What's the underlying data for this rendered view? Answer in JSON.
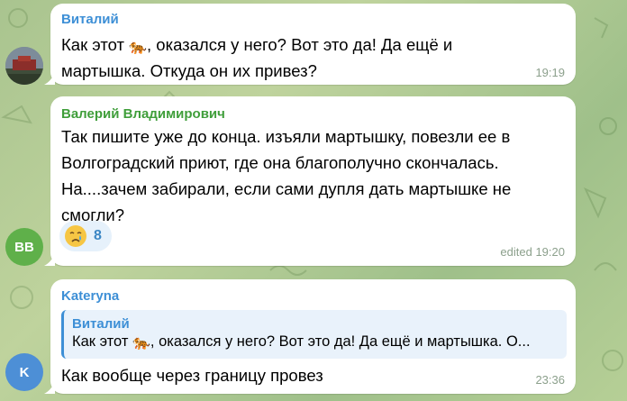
{
  "colors": {
    "vitaliy_name": "#3d8fd6",
    "valeriy_name": "#3f9e3a",
    "kateryna_name": "#3d8fd6",
    "bb_avatar": "#5fb04a",
    "k_avatar": "#4d8fd6",
    "time": "#8ca08c"
  },
  "messages": [
    {
      "sender": "Виталий",
      "lines": [
        "Как этот ",
        ", оказался у него? Вот это да! Да ещё и",
        "мартышка. Откуда он их привез?"
      ],
      "time": "19:19",
      "avatar_icon": "landscape-photo-avatar"
    },
    {
      "sender": "Валерий Владимирович",
      "lines": [
        "Так пишите уже до конца. изъяли мартышку, повезли ее в",
        "Волгоградский приют, где она благополучно скончалась.",
        "На....зачем забирали, если сами дупля дать мартышке не",
        "смогли?"
      ],
      "reaction": {
        "icon": "crying-face-icon",
        "count": "8"
      },
      "time": "edited 19:20",
      "avatar_initials": "BB"
    },
    {
      "sender": "Kateryna",
      "reply": {
        "name": "Виталий",
        "text_before": "Как этот ",
        "text_after": ", оказался у него? Вот это да! Да ещё и мартышка. О..."
      },
      "lines": [
        "Как вообще через границу провез"
      ],
      "time": "23:36",
      "avatar_initials": "K"
    }
  ]
}
